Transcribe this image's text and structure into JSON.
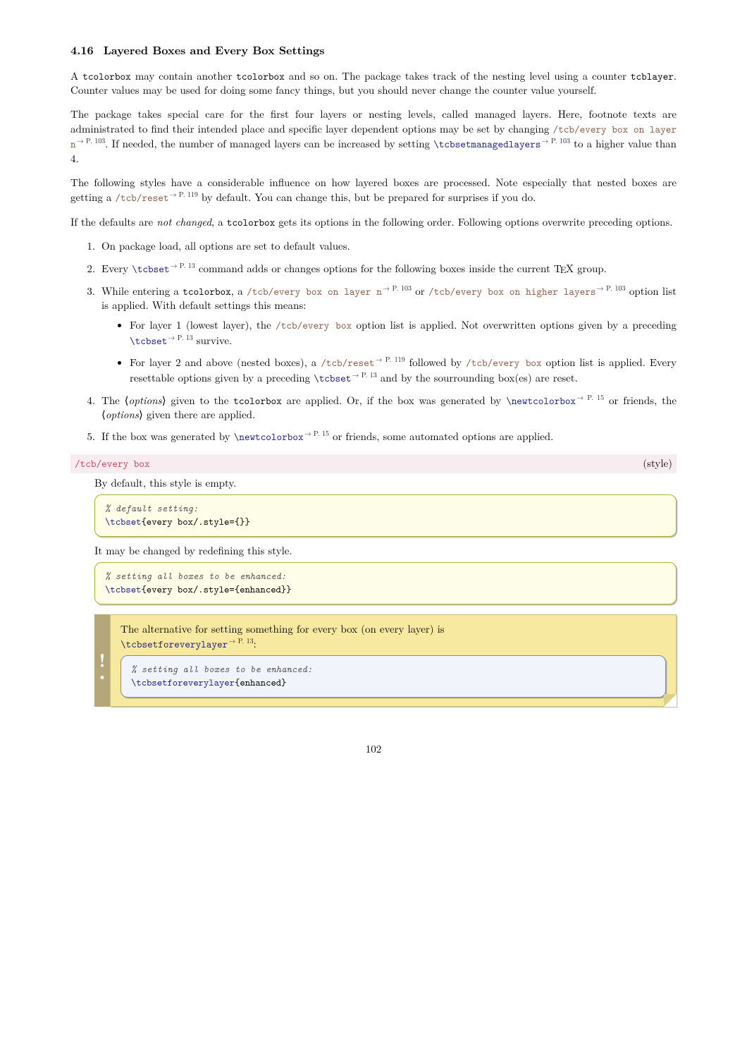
{
  "section": {
    "number": "4.16",
    "title": "Layered Boxes and Every Box Settings"
  },
  "para1_a": "A ",
  "para1_tcb1": "tcolorbox",
  "para1_b": " may contain another ",
  "para1_tcb2": "tcolorbox",
  "para1_c": " and so on. The package takes track of the nesting level using a counter ",
  "para1_cnt": "tcblayer",
  "para1_d": ". Counter values may be used for doing some fancy things, but you should never change the counter value yourself.",
  "para2_a": "The package takes special care for the first four layers or nesting levels, called managed layers. Here, footnote texts are administrated to find their intended place and specific layer dependent options may be set by changing ",
  "para2_key1": "/tcb/every box on layer n",
  "para2_ref1": "→ P. 103",
  "para2_b": ". If needed, the number of managed layers can be increased by setting ",
  "para2_cmd1": "\\tcbsetmanagedlayers",
  "para2_ref2": "→ P. 103",
  "para2_c": " to a higher value than 4.",
  "para3_a": "The following styles have a considerable influence on how layered boxes are processed. Note especially that nested boxes are getting a ",
  "para3_key1": "/tcb/reset",
  "para3_ref1": "→ P. 119",
  "para3_b": " by default. You can change this, but be prepared for surprises if you do.",
  "para4_a": "If the defaults are ",
  "para4_em": "not changed",
  "para4_b": ", a ",
  "para4_tcb": "tcolorbox",
  "para4_c": " gets its options in the following order. Following options overwrite preceding options.",
  "li1": "On package load, all options are set to default values.",
  "li2_a": "Every ",
  "li2_cmd": "\\tcbset",
  "li2_ref": "→ P. 13",
  "li2_b": " command adds or changes options for the following boxes inside the current ",
  "li2_tex": "TEX",
  "li2_c": " group.",
  "li3_a": "While entering a ",
  "li3_tcb": "tcolorbox",
  "li3_b": ", a ",
  "li3_key1": "/tcb/every box on layer n",
  "li3_ref1": "→ P. 103",
  "li3_c": " or ",
  "li3_key2": "/tcb/every box on higher layers",
  "li3_ref2": "→ P. 103",
  "li3_d": " option list is applied. With default settings this means:",
  "li3i_a": "For layer 1 (lowest layer), the ",
  "li3i_key": "/tcb/every box",
  "li3i_b": " option list is applied. Not overwritten options given by a preceding ",
  "li3i_cmd": "\\tcbset",
  "li3i_ref": "→ P. 13",
  "li3i_c": " survive.",
  "li3ii_a": "For layer 2 and above (nested boxes), a ",
  "li3ii_key1": "/tcb/reset",
  "li3ii_ref1": "→ P. 119",
  "li3ii_b": " followed by ",
  "li3ii_key2": "/tcb/every box",
  "li3ii_c": " option list is applied. Every resettable options given by a preceding ",
  "li3ii_cmd": "\\tcbset",
  "li3ii_ref2": "→ P. 13",
  "li3ii_d": " and by the sourrounding box(es) are reset.",
  "li4_a": "The ⟨",
  "li4_em1": "options",
  "li4_b": "⟩ given to the ",
  "li4_tcb": "tcolorbox",
  "li4_c": " are applied. Or, if the box was generated by ",
  "li4_cmd": "\\newtcolorbox",
  "li4_ref": "→ P. 15",
  "li4_d": " or friends, the ⟨",
  "li4_em2": "options",
  "li4_e": "⟩ given there are applied.",
  "li5_a": "If the box was generated by ",
  "li5_cmd": "\\newtcolorbox",
  "li5_ref": "→ P. 15",
  "li5_b": " or friends, some automated options are applied.",
  "keydoc": {
    "name": "/tcb/every box",
    "type": "(style)"
  },
  "keybody_intro": "By default, this style is empty.",
  "code1_comment": "% default setting:",
  "code1_cmd": "\\tcbset",
  "code1_rest": "{every box/.style={}}",
  "keybody_mid": "It may be changed by redefining this style.",
  "code2_comment": "% setting all boxes to be enhanced:",
  "code2_cmd": "\\tcbset",
  "code2_rest": "{every box/.style={enhanced}}",
  "note_a": "The alternative for setting something for every box (on every layer) is",
  "note_cmd": "\\tcbsetforeverylayer",
  "note_ref": "→ P. 13",
  "note_colon": ":",
  "code3_comment": "% setting all boxes to be enhanced:",
  "code3_cmd": "\\tcbsetforeverylayer",
  "code3_rest": "{enhanced}",
  "page_number": "102"
}
